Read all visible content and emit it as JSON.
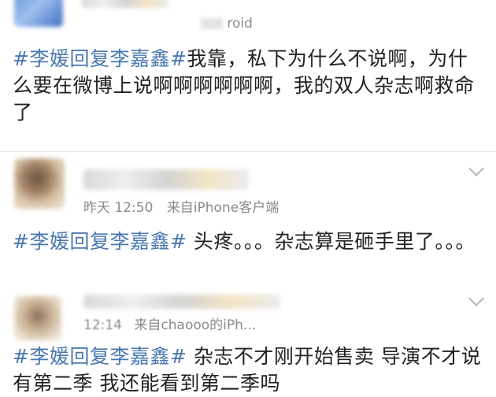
{
  "posts": [
    {
      "name": "",
      "meta_tail": "roid",
      "hashtag": "#李媛回复李嘉鑫#",
      "text": "我靠，私下为什么不说啊，为什么要在微博上说啊啊啊啊啊啊，我的双人杂志啊救命了"
    },
    {
      "name": "",
      "time": "昨天 12:50",
      "source": "来自iPhone客户端",
      "hashtag": "#李媛回复李嘉鑫#",
      "text": " 头疼。。。杂志算是砸手里了。。。"
    },
    {
      "name": "",
      "time": "12:14",
      "source": "来自chaooo的iPh...",
      "hashtag": "#李媛回复李嘉鑫#",
      "text": " 杂志不才刚开始售卖 导演不才说有第二季 我还能看到第二季吗"
    }
  ],
  "colors": {
    "hashtag": "#4a78b0",
    "meta": "#8a8a8a",
    "text": "#222222"
  },
  "icons": [
    "chevron-down-icon"
  ]
}
